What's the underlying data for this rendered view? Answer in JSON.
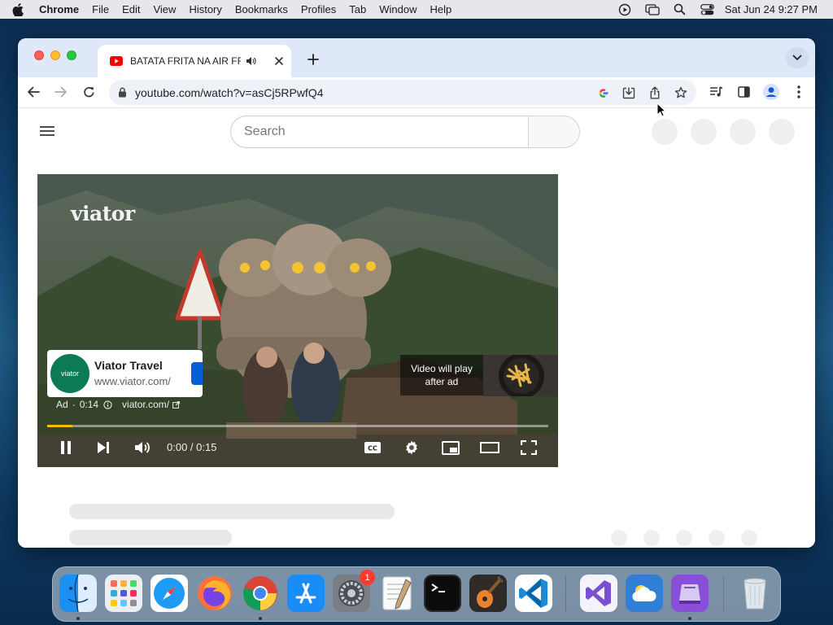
{
  "menubar": {
    "app_name": "Chrome",
    "items": [
      "File",
      "Edit",
      "View",
      "History",
      "Bookmarks",
      "Profiles",
      "Tab",
      "Window",
      "Help"
    ],
    "clock": "Sat Jun 24  9:27 PM"
  },
  "browser": {
    "tab": {
      "title": "BATATA FRITA NA AIR FRYER"
    },
    "url": "youtube.com/watch?v=asCj5RPwfQ4"
  },
  "youtube": {
    "search_placeholder": "Search",
    "player": {
      "logo_text": "viator",
      "ad_avatar_text": "viator",
      "advertiser_name": "Viator Travel",
      "advertiser_url": "www.viator.com/",
      "ad_label": "Ad",
      "ad_countdown": "0:14",
      "ad_domain": "viator.com/",
      "play_after_ad": "Video will play after ad",
      "time": "0:00 / 0:15",
      "progress_fraction": 0.05,
      "cc_label": "CC"
    }
  },
  "dock": {
    "apps": [
      {
        "name": "Finder",
        "running": true
      },
      {
        "name": "Launchpad",
        "running": false
      },
      {
        "name": "Safari",
        "running": false
      },
      {
        "name": "Firefox",
        "running": false
      },
      {
        "name": "Google Chrome",
        "running": true
      },
      {
        "name": "App Store",
        "running": false
      },
      {
        "name": "System Settings",
        "running": false,
        "badge": "1"
      },
      {
        "name": "TextEdit",
        "running": false
      },
      {
        "name": "Terminal",
        "running": false
      },
      {
        "name": "GarageBand",
        "running": false
      },
      {
        "name": "Visual Studio Code",
        "running": false
      },
      {
        "name": "Visual Studio",
        "running": false
      },
      {
        "name": "Weather",
        "running": false
      },
      {
        "name": "Simulator",
        "running": true
      },
      {
        "name": "Trash",
        "running": false
      }
    ]
  }
}
